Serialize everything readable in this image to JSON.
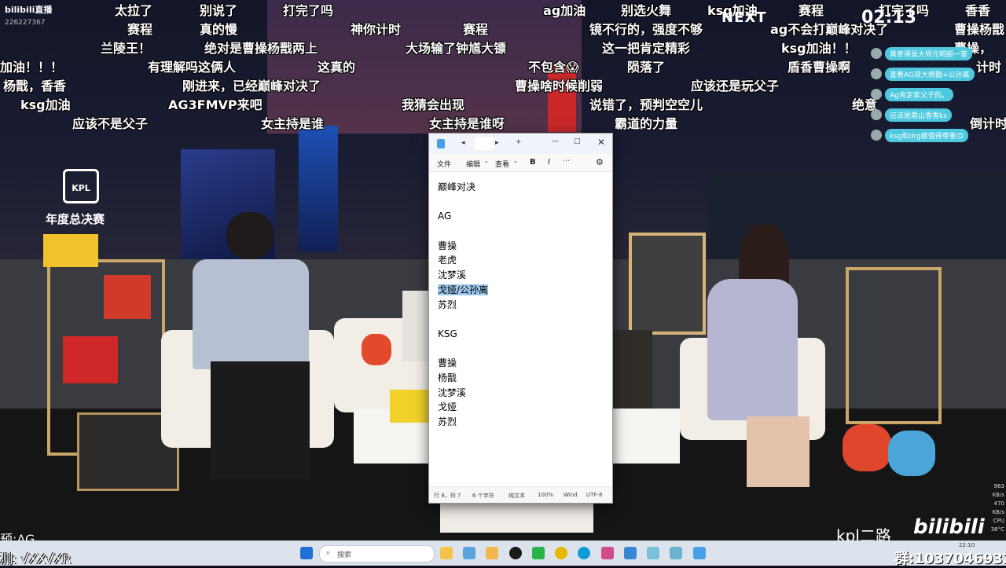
{
  "stream": {
    "logo_text": "bilibili直播",
    "room_id": "226227367",
    "next_label": "NEXT",
    "timer": "02:13",
    "kpl_logo": "KPL",
    "event_label": "年度总决赛",
    "kpl_channel": "kpl二路",
    "brand": "bilibili",
    "group_number": "群:1037046932",
    "prediction_line": "预:AG",
    "test_line": "测: √XX√XR",
    "sys_stats": [
      "963",
      "KB/s",
      "470",
      "KB/s",
      "CPU",
      "38°C"
    ]
  },
  "danmaku": [
    "太拉了",
    "别说了",
    "打完了吗",
    "ag加油",
    "别选火舞",
    "ksg加油",
    "赛程",
    "打完了吗",
    "香香",
    "赛程",
    "真的慢",
    "神你计时",
    "赛程",
    "镜不行的，强度不够",
    "ag不会打巅峰对决了",
    "曹操杨戬",
    "兰陵王！",
    "绝对是曹操杨戬两上",
    "大场输了钟馗大镖",
    "这一把肯定精彩",
    "ksg加油！！",
    "曹操，",
    "加油！！！",
    "有理解吗这俩人",
    "这真的",
    "不包含😱",
    "陨落了",
    "盾香曹操啊",
    "计时",
    "杨戬，香香",
    "刚进来，已经巅峰对决了",
    "曹操啥时候削弱",
    "应该还是玩父子",
    "ksg加油",
    "AG3FMVP来吧",
    "我猜会出现",
    "说错了，预判空空儿",
    "绝意",
    "应该不是父子",
    "女主持是谁",
    "女主持是谁呀",
    "霸道的力量",
    "倒计时"
  ],
  "chat": [
    "真意得是大师元明部一答",
    "查看AG双大杨戬+公孙离",
    "Ag肯定拿父子的。",
    "应该是盾山香香ks",
    "ksg和drg都值得尊重😊"
  ],
  "notepad": {
    "tab_title": "巅峰对决",
    "menu_file": "文件",
    "menu_edit": "编辑",
    "menu_view": "查看",
    "bold": "B",
    "italic": "I",
    "lines": [
      "巅峰对决",
      "",
      "AG",
      "",
      "曹操",
      "老虎",
      "沈梦溪",
      "戈娅/公孙离",
      "苏烈",
      "",
      "KSG",
      "",
      "曹操",
      "杨戬",
      "沈梦溪",
      "戈娅",
      "苏烈"
    ],
    "selected_line_index": 7,
    "status_pos": "行 8，列 7",
    "status_chars": "6 个字符",
    "status_mode": "纯文本",
    "status_zoom": "100%",
    "status_eol": "Wind",
    "status_enc": "UTF-8"
  },
  "taskbar": {
    "search_placeholder": "搜索",
    "time": "22:10",
    "colors": {
      "start": "#1f6fd6",
      "edge": "#0f9bd7",
      "qq": "#1a1a1a",
      "chrome": "#e6b800",
      "notepad": "#4aa0e6"
    }
  }
}
